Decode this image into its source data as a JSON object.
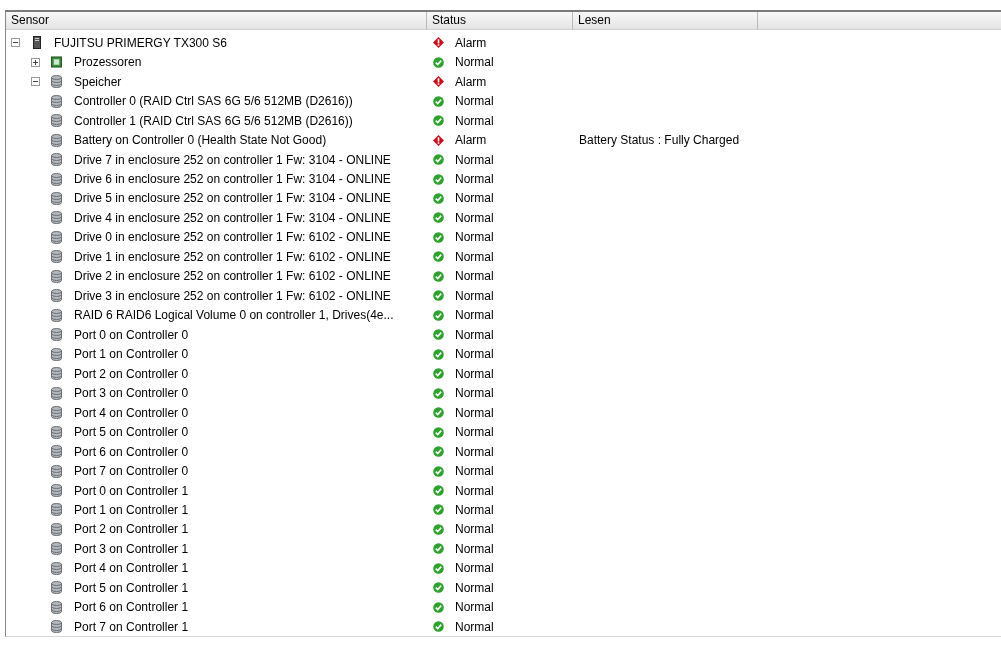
{
  "table": {
    "columns": [
      "Sensor",
      "Status",
      "Lesen"
    ],
    "rows": [
      {
        "label": "FUJITSU PRIMERGY TX300 S6",
        "kind": "server",
        "expanded": true,
        "status": {
          "label": "Alarm",
          "kind": "alarm"
        },
        "children": [
          {
            "label": "Prozessoren",
            "kind": "processor",
            "expanded": false,
            "status": {
              "label": "Normal",
              "kind": "normal"
            }
          },
          {
            "label": "Speicher",
            "kind": "storage",
            "expanded": true,
            "status": {
              "label": "Alarm",
              "kind": "alarm"
            },
            "children": [
              {
                "label": "Controller 0 (RAID Ctrl SAS 6G 5/6 512MB (D2616))",
                "kind": "storage",
                "status": {
                  "label": "Normal",
                  "kind": "normal"
                }
              },
              {
                "label": "Controller 1 (RAID Ctrl SAS 6G 5/6 512MB (D2616))",
                "kind": "storage",
                "status": {
                  "label": "Normal",
                  "kind": "normal"
                }
              },
              {
                "label": "Battery on Controller 0 (Health State Not Good)",
                "kind": "storage",
                "status": {
                  "label": "Alarm",
                  "kind": "alarm"
                },
                "reading": "Battery Status : Fully Charged"
              },
              {
                "label": "Drive 7 in enclosure 252 on controller 1 Fw: 3104 - ONLINE",
                "kind": "storage",
                "status": {
                  "label": "Normal",
                  "kind": "normal"
                }
              },
              {
                "label": "Drive 6 in enclosure 252 on controller 1 Fw: 3104 - ONLINE",
                "kind": "storage",
                "status": {
                  "label": "Normal",
                  "kind": "normal"
                }
              },
              {
                "label": "Drive 5 in enclosure 252 on controller 1 Fw: 3104 - ONLINE",
                "kind": "storage",
                "status": {
                  "label": "Normal",
                  "kind": "normal"
                }
              },
              {
                "label": "Drive 4 in enclosure 252 on controller 1 Fw: 3104 - ONLINE",
                "kind": "storage",
                "status": {
                  "label": "Normal",
                  "kind": "normal"
                }
              },
              {
                "label": "Drive 0 in enclosure 252 on controller 1 Fw: 6102 - ONLINE",
                "kind": "storage",
                "status": {
                  "label": "Normal",
                  "kind": "normal"
                }
              },
              {
                "label": "Drive 1 in enclosure 252 on controller 1 Fw: 6102 - ONLINE",
                "kind": "storage",
                "status": {
                  "label": "Normal",
                  "kind": "normal"
                }
              },
              {
                "label": "Drive 2 in enclosure 252 on controller 1 Fw: 6102 - ONLINE",
                "kind": "storage",
                "status": {
                  "label": "Normal",
                  "kind": "normal"
                }
              },
              {
                "label": "Drive 3 in enclosure 252 on controller 1 Fw: 6102 - ONLINE",
                "kind": "storage",
                "status": {
                  "label": "Normal",
                  "kind": "normal"
                }
              },
              {
                "label": "RAID 6 RAID6 Logical Volume 0 on controller 1, Drives(4e...",
                "kind": "storage",
                "status": {
                  "label": "Normal",
                  "kind": "normal"
                }
              },
              {
                "label": "Port 0 on Controller 0",
                "kind": "storage",
                "status": {
                  "label": "Normal",
                  "kind": "normal"
                }
              },
              {
                "label": "Port 1 on Controller 0",
                "kind": "storage",
                "status": {
                  "label": "Normal",
                  "kind": "normal"
                }
              },
              {
                "label": "Port 2 on Controller 0",
                "kind": "storage",
                "status": {
                  "label": "Normal",
                  "kind": "normal"
                }
              },
              {
                "label": "Port 3 on Controller 0",
                "kind": "storage",
                "status": {
                  "label": "Normal",
                  "kind": "normal"
                }
              },
              {
                "label": "Port 4 on Controller 0",
                "kind": "storage",
                "status": {
                  "label": "Normal",
                  "kind": "normal"
                }
              },
              {
                "label": "Port 5 on Controller 0",
                "kind": "storage",
                "status": {
                  "label": "Normal",
                  "kind": "normal"
                }
              },
              {
                "label": "Port 6 on Controller 0",
                "kind": "storage",
                "status": {
                  "label": "Normal",
                  "kind": "normal"
                }
              },
              {
                "label": "Port 7 on Controller 0",
                "kind": "storage",
                "status": {
                  "label": "Normal",
                  "kind": "normal"
                }
              },
              {
                "label": "Port 0 on Controller 1",
                "kind": "storage",
                "status": {
                  "label": "Normal",
                  "kind": "normal"
                }
              },
              {
                "label": "Port 1 on Controller 1",
                "kind": "storage",
                "status": {
                  "label": "Normal",
                  "kind": "normal"
                }
              },
              {
                "label": "Port 2 on Controller 1",
                "kind": "storage",
                "status": {
                  "label": "Normal",
                  "kind": "normal"
                }
              },
              {
                "label": "Port 3 on Controller 1",
                "kind": "storage",
                "status": {
                  "label": "Normal",
                  "kind": "normal"
                }
              },
              {
                "label": "Port 4 on Controller 1",
                "kind": "storage",
                "status": {
                  "label": "Normal",
                  "kind": "normal"
                }
              },
              {
                "label": "Port 5 on Controller 1",
                "kind": "storage",
                "status": {
                  "label": "Normal",
                  "kind": "normal"
                }
              },
              {
                "label": "Port 6 on Controller 1",
                "kind": "storage",
                "status": {
                  "label": "Normal",
                  "kind": "normal"
                }
              },
              {
                "label": "Port 7 on Controller 1",
                "kind": "storage",
                "status": {
                  "label": "Normal",
                  "kind": "normal"
                }
              }
            ]
          }
        ]
      }
    ]
  }
}
